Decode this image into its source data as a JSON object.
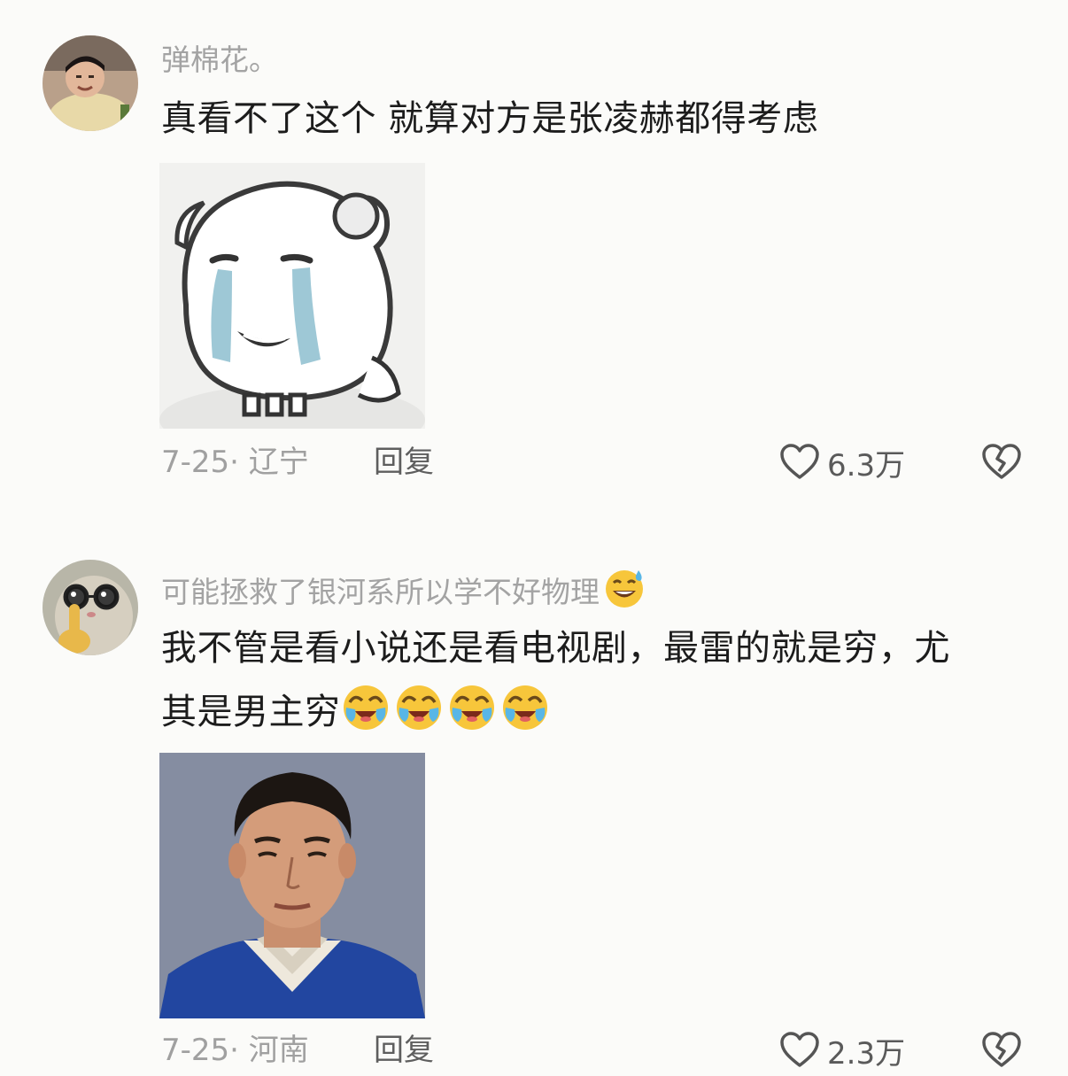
{
  "comments": [
    {
      "username": "弹棉花。",
      "text": "真看不了这个 就算对方是张凌赫都得考虑",
      "media": "crying-bear-meme",
      "date_location": "7-25· 辽宁",
      "reply_label": "回复",
      "likes": "6.3万",
      "avatar": "child-photo-avatar"
    },
    {
      "username": "可能拯救了银河系所以学不好物理",
      "username_emoji": "sweat-smile-emoji",
      "text_line1": "我不管是看小说还是看电视剧，最雷的就是穷，尤",
      "text_line2": "其是男主穷",
      "text_emojis": [
        "crying-laughing-emoji",
        "crying-laughing-emoji",
        "crying-laughing-emoji",
        "crying-laughing-emoji"
      ],
      "media": "young-man-portrait-photo",
      "date_location": "7-25· 河南",
      "reply_label": "回复",
      "likes": "2.3万",
      "avatar": "hamster-glasses-avatar"
    }
  ],
  "colors": {
    "background": "#fbfbf9",
    "username": "#a3a3a3",
    "text": "#1c1c1c",
    "meta": "#a0a0a0",
    "reply": "#5e5e5e"
  }
}
